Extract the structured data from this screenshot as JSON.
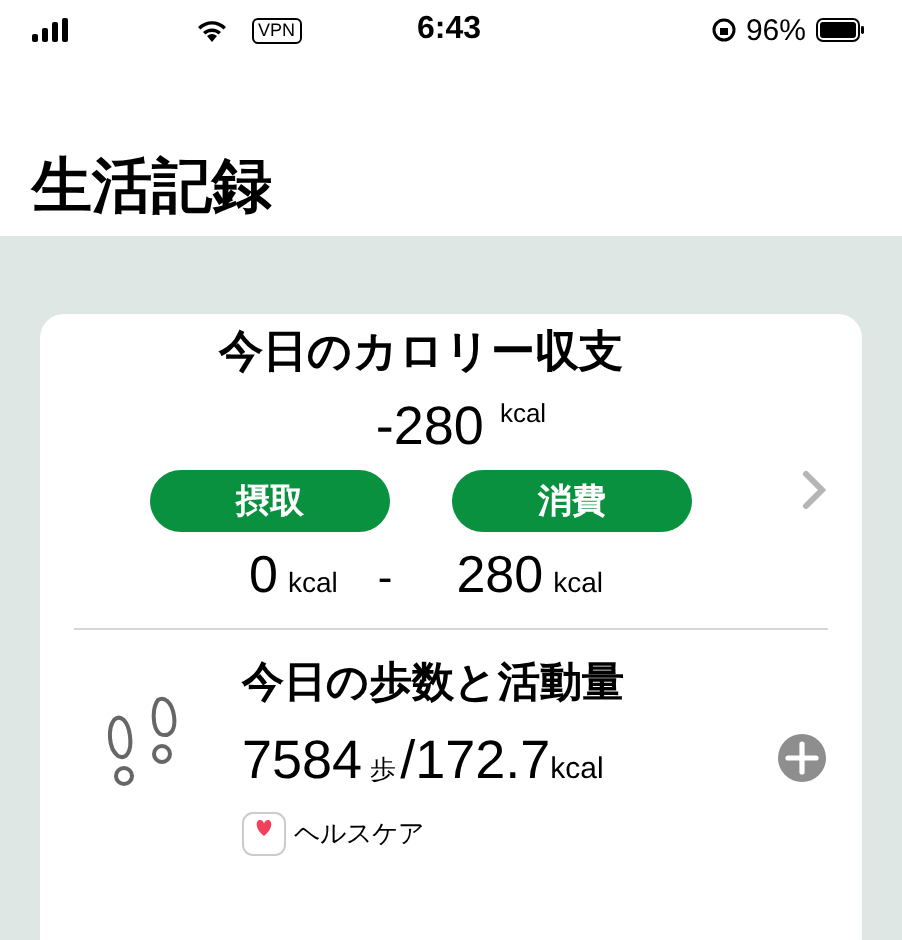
{
  "status_bar": {
    "vpn": "VPN",
    "time": "6:43",
    "battery": "96%"
  },
  "page_title": "生活記録",
  "calorie_card": {
    "title": "今日のカロリー収支",
    "balance": "-280",
    "balance_unit": "kcal",
    "intake": {
      "label": "摂取",
      "value": "0",
      "unit": "kcal"
    },
    "separator": "-",
    "burned": {
      "label": "消費",
      "value": "280",
      "unit": "kcal"
    }
  },
  "activity": {
    "title": "今日の歩数と活動量",
    "steps": "7584",
    "steps_unit": "歩",
    "slash": "/",
    "calories": "172.7",
    "calories_unit": "kcal",
    "source": "ヘルスケア"
  }
}
